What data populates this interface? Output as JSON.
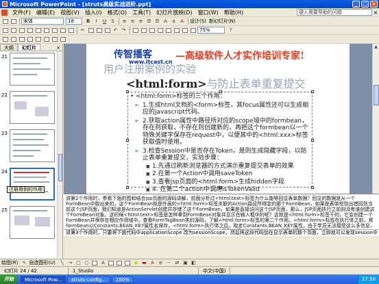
{
  "window": {
    "title": "Microsoft PowerPoint - [struts高级实战进阶.ppt]"
  },
  "menu": {
    "items": [
      "文件(F)",
      "编辑(E)",
      "视图(V)",
      "插入(I)",
      "格式(O)",
      "工具(T)",
      "幻灯片放映(D)",
      "窗口(W)",
      "帮助(H)"
    ],
    "help_placeholder": "键入需要帮助的问题"
  },
  "toolbar": {
    "font_name": "宋体",
    "font_size": "18",
    "bold": "B",
    "italic": "I",
    "underline": "U",
    "shadow": "S",
    "design_label": "设计(S)",
    "new_slide_label": "新幻灯片(N)",
    "zoom": "75%"
  },
  "leftpane": {
    "tabs": [
      "大纲",
      "幻灯片"
    ],
    "close": "×",
    "thumbnails": [
      {
        "num": "21"
      },
      {
        "num": "22"
      },
      {
        "num": "23"
      },
      {
        "num": "24"
      },
      {
        "num": "25"
      }
    ],
    "tooltip": "注册用例的作用"
  },
  "slide": {
    "logo": "传智播客",
    "logo_url": "www.itcast.cn",
    "slogan": "—高级软件人才实作培训专家!",
    "old_title": "用户注册案例的实验",
    "title_tag": "<html:form>",
    "title_rest": "与防止表单重复提交",
    "bullets": [
      {
        "level": 1,
        "text": "<html:form>标签的三个作用："
      },
      {
        "level": 2,
        "text": "1.生成html文档的<form>标签，其focus属性还可以生成相应的javascript代码。"
      },
      {
        "level": 2,
        "text": "2.获取action属性中路径所对应的scope域中的formbean，存在则获取，不存在则创建新的，再把这个formbean以一个特殊关键字保存在request中，以便其中的<html:xxx>标签获取值时使用。"
      },
      {
        "level": 2,
        "text": "3.检查Session中是否存在Token，是则生成隐藏字段，以防止表单重复提交，实验步骤："
      },
      {
        "level": 3,
        "text": "1.先通过刷新浏览器的方式演示重复提交表单的效果"
      },
      {
        "level": 3,
        "text": "2.在第一个Action中调用saveToken"
      },
      {
        "level": 3,
        "text": "3.查看jsp页面的<html:form>生成hidden字段"
      },
      {
        "level": 3,
        "text": "4. 在第二个action中调用isTokenValid"
      }
    ]
  },
  "notes": {
    "text": "讲第2个作用时，参看下面的图和结合jsp页面的源码讲解，前面分析过<html:text>标签为什么能够回显表单数据？回显的数据是从一个FormBean中取出来的，这个FormBean就是外层的<html:form>标签关联的Action路径所绑定的那个FormBean。如果是表单校验出错回到当前这个JSP页面，我们知道是ActionServlet创建并存储了这个FormBean，如果是直接访问这个JSP页面，那么，JSP页面执行之前则没有谁创建这个FormBean对象。这时候<html:text>标签是怎样拿到FormBean对象并显示在输入框中的呢？这就是<html:form>标签干的，它会创建一个FormBean并保存在相应作用域中。查看FormTagBean类的源码，了解<html:form>标签的第二个作用。<html:form>标签在执行体之前，将formbean以Constants.BEAN_KEY属性名保存，<html:form>执行体之后，取走Constants.BEAN_KEY属性，由于学员无法接受这么多信息，这里的源代码我不作过多分析了。在这里最加一个int类型的height属性，看到其初始值被填充为70，大家都直知地感受到了<html:formbean>标签会创建新的formbean和<html:text>标签会显示出这个formbean中的相应属性的初始值。",
    "line2": "讲第3个作用时，只要将下面代码中applicationScope 改为sessionScope，然后将这段代码加在显示表单的那个页面，立即就可以发现session中"
  },
  "drawbar": {
    "draw_label": "绘图(R)",
    "autoshape_label": "自选图形(U)"
  },
  "status": {
    "slide_pos": "幻灯片 24 / 42",
    "design": "1_Studio",
    "language": "中文(中国)"
  },
  "taskbar": {
    "start": "开始",
    "tasks": [
      "Microsoft Pow...",
      "struts-config...",
      "100%"
    ],
    "clock": "17:50"
  }
}
